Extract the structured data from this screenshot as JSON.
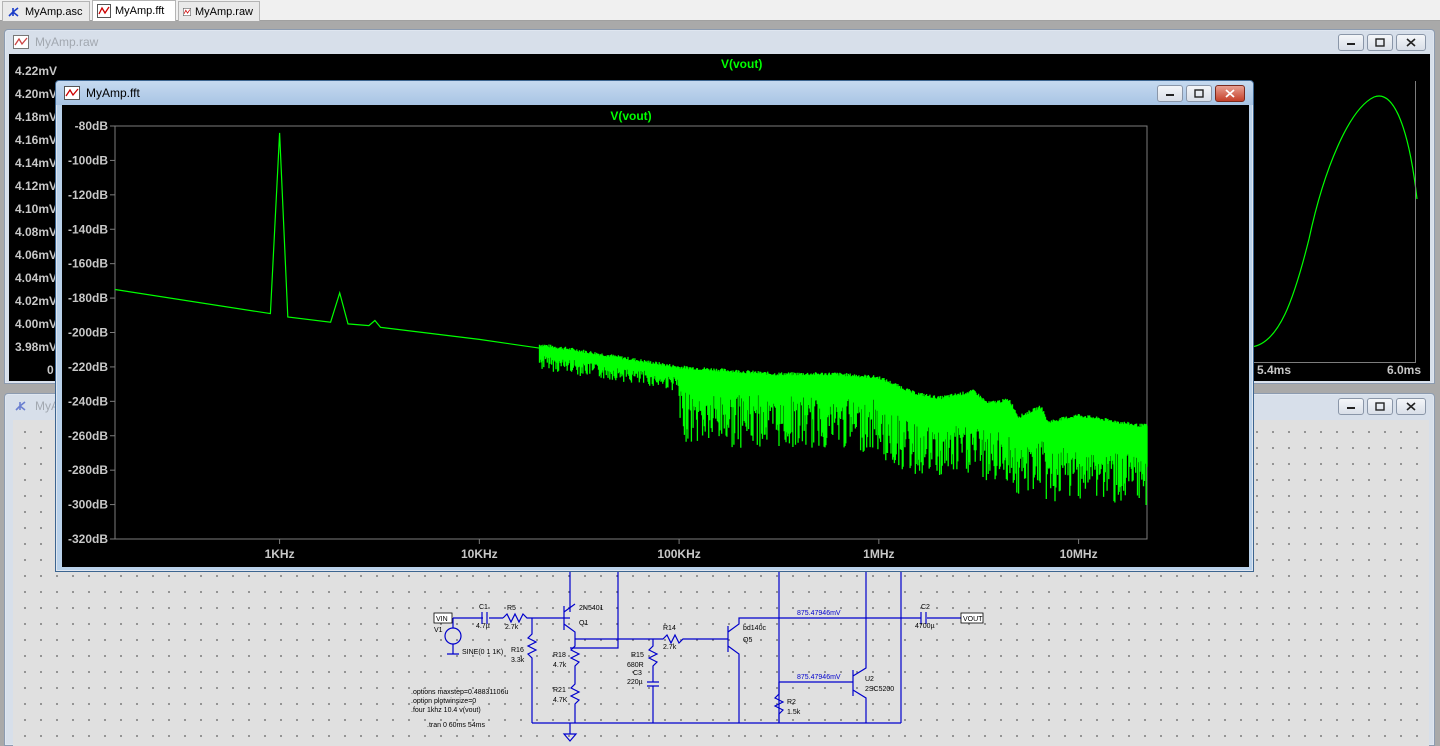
{
  "tabs": [
    {
      "label": "MyAmp.asc",
      "icon": "schematic-icon"
    },
    {
      "label": "MyAmp.fft",
      "icon": "waveform-icon"
    },
    {
      "label": "MyAmp.raw",
      "icon": "waveform-icon"
    }
  ],
  "raw_window": {
    "title": "MyAmp.raw",
    "trace": "V(vout)",
    "y_ticks": [
      "4.22mV",
      "4.20mV",
      "4.18mV",
      "4.16mV",
      "4.14mV",
      "4.12mV",
      "4.10mV",
      "4.08mV",
      "4.06mV",
      "4.04mV",
      "4.02mV",
      "4.00mV",
      "3.98mV"
    ],
    "x_first_tick": "0",
    "x_ticks": [
      "5.4ms",
      "6.0ms"
    ]
  },
  "fft_window": {
    "title": "MyAmp.fft",
    "trace": "V(vout)"
  },
  "schematic_window": {
    "title": "MyAmp.asc",
    "labels": {
      "vin": "VIN",
      "vout": "VOUT",
      "c1": "C1",
      "c1v": "4.7µ",
      "r5": "R5",
      "r5v": "2.7k",
      "q1": "Q1",
      "q1m": "2N5401",
      "v1": "V1",
      "v1v": "SINE(0 1 1K)",
      "r16": "R16",
      "r16v": "3.3k",
      "r18": "R18",
      "r18v": "4.7k",
      "r21": "R21",
      "r21v": "4.7K",
      "r14": "R14",
      "r14v": "2.7k",
      "r15": "R15",
      "r15v": "680R",
      "c3": "C3",
      "c3v": "220µ",
      "q5": "Q5",
      "q5m": "bd140c",
      "r2": "R2",
      "r2v": "1.5k",
      "u2": "U2",
      "u2m": "2SC5200",
      "c2": "C2",
      "c2v": "4700µ",
      "node1": "875.47946mV",
      "node2": "875.47946mV"
    },
    "directives": [
      ".options maxstep=0.48831106u",
      ".option plotwinsize=0",
      ".four 1khz 10.4 v(vout)",
      ".tran 0 60ms 54ms"
    ]
  },
  "chart_data": {
    "type": "line",
    "title": "V(vout)",
    "xscale": "log",
    "xlim": [
      150,
      22000000
    ],
    "ylim": [
      -320,
      -80
    ],
    "x_ticks": [
      "1KHz",
      "10KHz",
      "100KHz",
      "1MHz",
      "10MHz"
    ],
    "y_ticks": [
      "-80dB",
      "-100dB",
      "-120dB",
      "-140dB",
      "-160dB",
      "-180dB",
      "-200dB",
      "-220dB",
      "-240dB",
      "-260dB",
      "-280dB",
      "-300dB",
      "-320dB"
    ],
    "series": [
      {
        "color": "#00ff00",
        "points": [
          [
            150,
            -175
          ],
          [
            900,
            -189
          ],
          [
            1000,
            -84
          ],
          [
            1100,
            -191
          ],
          [
            1800,
            -194
          ],
          [
            2000,
            -177
          ],
          [
            2200,
            -195
          ],
          [
            2800,
            -196
          ],
          [
            3000,
            -193
          ],
          [
            3200,
            -197
          ],
          [
            10000,
            -204
          ],
          [
            30000,
            -212
          ],
          [
            100000,
            -222
          ],
          [
            300000,
            -226
          ],
          [
            600000,
            -226
          ],
          [
            1000000,
            -228
          ],
          [
            1500000,
            -237
          ],
          [
            2000000,
            -240
          ],
          [
            3000000,
            -236
          ],
          [
            3500000,
            -243
          ],
          [
            4500000,
            -241
          ],
          [
            5000000,
            -251
          ],
          [
            6500000,
            -245
          ],
          [
            7000000,
            -254
          ],
          [
            10000000,
            -250
          ],
          [
            20000000,
            -256
          ]
        ]
      }
    ]
  }
}
